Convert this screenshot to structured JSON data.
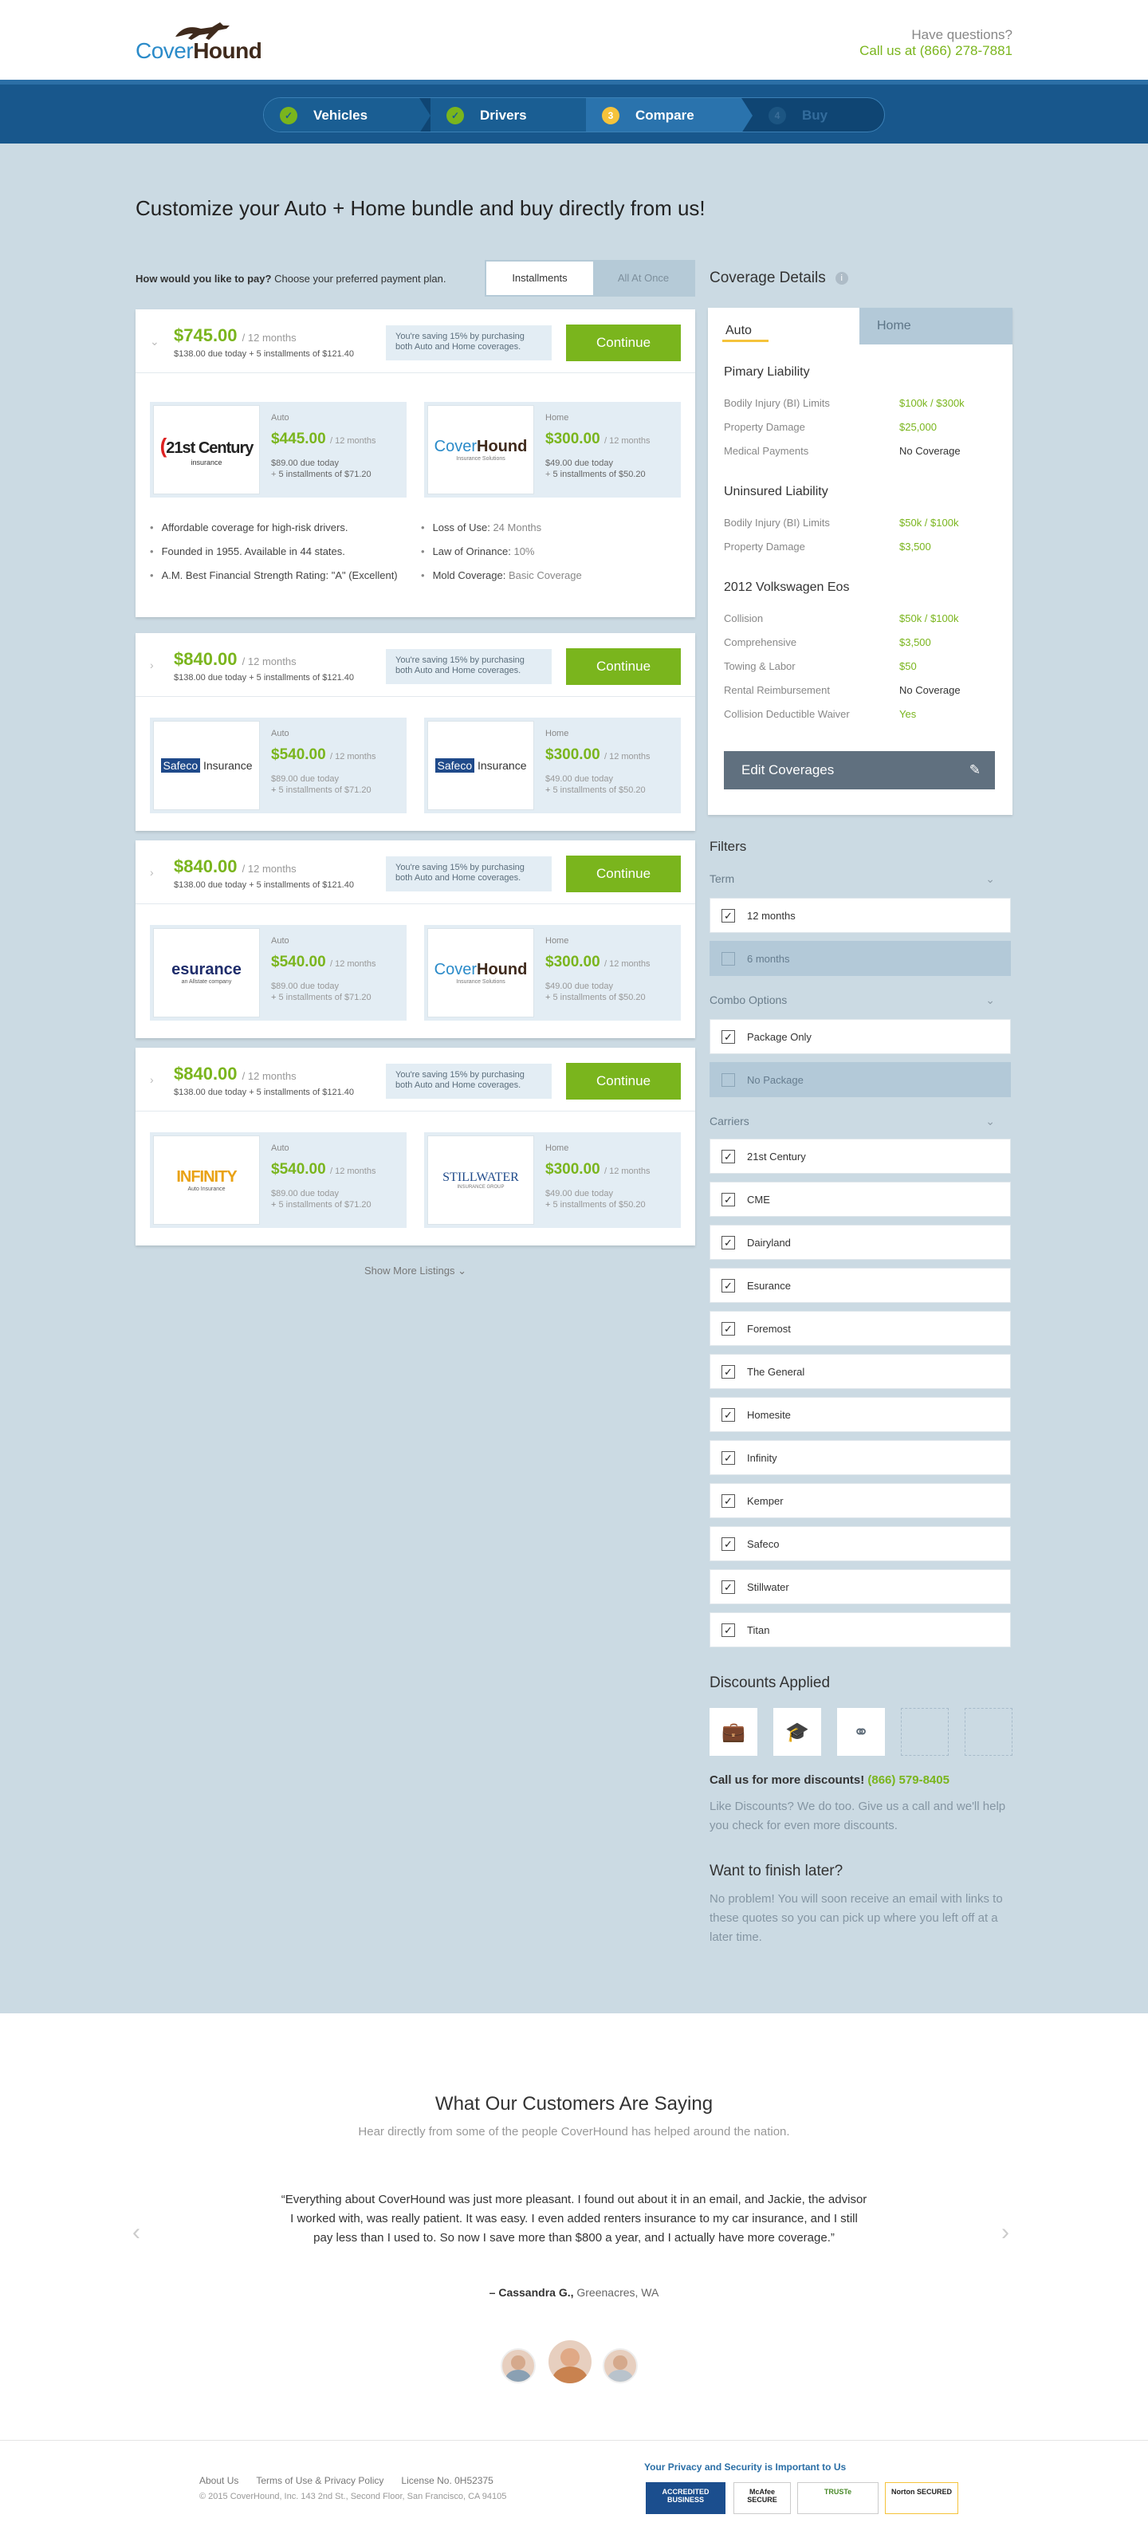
{
  "header": {
    "logo_a": "Cover",
    "logo_b": "Hound",
    "question": "Have questions?",
    "phone": "Call us at (866) 278-7881"
  },
  "steps": [
    {
      "num": "✓",
      "label": "Vehicles"
    },
    {
      "num": "✓",
      "label": "Drivers"
    },
    {
      "num": "3",
      "label": "Compare"
    },
    {
      "num": "4",
      "label": "Buy"
    }
  ],
  "page": {
    "title": "Customize your Auto + Home bundle and buy directly from us!",
    "pay_q": "How would you like to pay?",
    "pay_hint": "Choose your preferred payment plan.",
    "pay_opt1": "Installments",
    "pay_opt2": "All At Once"
  },
  "listings": [
    {
      "price": "$745.00",
      "term": "/ 12 months",
      "due": "$138.00 due today + 5 installments of $121.40",
      "saving": "You're saving 15% by purchasing both Auto and Home coverages.",
      "cta": "Continue",
      "auto": {
        "type": "Auto",
        "logo": "21st Century",
        "logo_sub": "insurance",
        "price": "$445.00",
        "term": "/ 12 months",
        "due": "$89.00 due today",
        "inst": "5 installments of $71.20"
      },
      "home": {
        "type": "Home",
        "logo_a": "Cover",
        "logo_b": "Hound",
        "logo_sub": "Insurance Solutions",
        "price": "$300.00",
        "term": "/ 12 months",
        "due": "$49.00 due today",
        "inst": "5 installments of $50.20"
      }
    },
    {
      "price": "$840.00",
      "term": "/ 12 months",
      "due": "$138.00 due today + 5 installments of $121.40",
      "saving": "You're saving 15% by purchasing both Auto and Home coverages.",
      "cta": "Continue",
      "auto": {
        "type": "Auto",
        "logo_a": "Safeco",
        "logo_b": "Insurance",
        "price": "$540.00",
        "term": "/ 12 months",
        "due": "$89.00 due today",
        "inst": "5 installments of $71.20"
      },
      "home": {
        "type": "Home",
        "logo_a": "Safeco",
        "logo_b": "Insurance",
        "price": "$300.00",
        "term": "/ 12 months",
        "due": "$49.00 due today",
        "inst": "5 installments of $50.20"
      }
    },
    {
      "price": "$840.00",
      "term": "/ 12 months",
      "due": "$138.00 due today + 5 installments of $121.40",
      "saving": "You're saving 15% by purchasing both Auto and Home coverages.",
      "cta": "Continue",
      "auto": {
        "type": "Auto",
        "logo": "esurance",
        "logo_sub": "an Allstate company",
        "price": "$540.00",
        "term": "/ 12 months",
        "due": "$89.00 due today",
        "inst": "5 installments of $71.20"
      },
      "home": {
        "type": "Home",
        "logo_a": "Cover",
        "logo_b": "Hound",
        "logo_sub": "Insurance Solutions",
        "price": "$300.00",
        "term": "/ 12 months",
        "due": "$49.00 due today",
        "inst": "5 installments of $50.20"
      }
    },
    {
      "price": "$840.00",
      "term": "/ 12 months",
      "due": "$138.00 due today + 5 installments of $121.40",
      "saving": "You're saving 15% by purchasing both Auto and Home coverages.",
      "cta": "Continue",
      "auto": {
        "type": "Auto",
        "logo": "INFINITY",
        "logo_sub": "Auto Insurance",
        "price": "$540.00",
        "term": "/ 12 months",
        "due": "$89.00 due today",
        "inst": "5 installments of $71.20"
      },
      "home": {
        "type": "Home",
        "logo": "STILLWATER",
        "logo_sub": "INSURANCE GROUP",
        "price": "$300.00",
        "term": "/ 12 months",
        "due": "$49.00 due today",
        "inst": "5 installments of $50.20"
      }
    }
  ],
  "features_left": [
    "Affordable coverage for high-risk drivers.",
    "Founded in 1955. Available in 44 states.",
    "A.M. Best Financial Strength Rating: \"A\" (Excellent)"
  ],
  "features_right": [
    {
      "label": "Loss of Use:",
      "value": "24 Months"
    },
    {
      "label": "Law of Orinance:",
      "value": "10%"
    },
    {
      "label": "Mold Coverage:",
      "value": "Basic Coverage"
    }
  ],
  "show_more": "Show More Listings",
  "coverage": {
    "title": "Coverage Details",
    "tab_auto": "Auto",
    "tab_home": "Home",
    "sections": [
      {
        "title": "Pimary Liability",
        "rows": [
          {
            "k": "Bodily Injury (BI) Limits",
            "v": "$100k / $300k"
          },
          {
            "k": "Property Damage",
            "v": "$25,000"
          },
          {
            "k": "Medical Payments",
            "v": "No Coverage"
          }
        ]
      },
      {
        "title": "Uninsured Liability",
        "rows": [
          {
            "k": "Bodily Injury (BI) Limits",
            "v": "$50k / $100k"
          },
          {
            "k": "Property Damage",
            "v": "$3,500"
          }
        ]
      },
      {
        "title": "2012 Volkswagen Eos",
        "rows": [
          {
            "k": "Collision",
            "v": "$50k / $100k"
          },
          {
            "k": "Comprehensive",
            "v": "$3,500"
          },
          {
            "k": "Towing & Labor",
            "v": "$50"
          },
          {
            "k": "Rental Reimbursement",
            "v": "No Coverage"
          },
          {
            "k": "Collision Deductible Waiver",
            "v": "Yes"
          }
        ]
      }
    ],
    "edit": "Edit Coverages"
  },
  "filters": {
    "title": "Filters",
    "term": "Term",
    "term_opts": [
      "12 months",
      "6 months"
    ],
    "combo": "Combo Options",
    "combo_opts": [
      "Package Only",
      "No Package"
    ],
    "carriers": "Carriers",
    "carrier_list": [
      "21st Century",
      "CME",
      "Dairyland",
      "Esurance",
      "Foremost",
      "The General",
      "Homesite",
      "Infinity",
      "Kemper",
      "Safeco",
      "Stillwater",
      "Titan"
    ]
  },
  "discounts": {
    "title": "Discounts Applied",
    "call": "Call us for more discounts!",
    "phone": "(866) 579-8405",
    "text": "Like Discounts? We do too. Give us a call and we'll help you check for even more discounts."
  },
  "later": {
    "title": "Want to finish later?",
    "text": "No problem! You will soon receive an email with links to these quotes so you can pick up where you left off at a later time."
  },
  "testimonials": {
    "title": "What Our Customers Are Saying",
    "subtitle": "Hear directly from some of the people CoverHound has helped around the nation.",
    "quote": "“Everything about CoverHound was just more pleasant. I found out about it in an email, and Jackie, the advisor I worked with, was really patient. It was easy. I even added renters insurance to my car insurance, and I still pay less than I used to. So now I save more than $800 a year, and I actually have more coverage.”",
    "author": "– Cassandra G.,",
    "location": "Greenacres, WA",
    "prev": "‹",
    "next": "›"
  },
  "footer": {
    "about": "About Us",
    "terms": "Terms of Use & Privacy Policy",
    "license": "License No. 0H52375",
    "copy": "© 2015 CoverHound, Inc. 143 2nd St., Second Floor, San Francisco, CA 94105",
    "security": "Your Privacy and Security is Important to Us",
    "badges": [
      "ACCREDITED BUSINESS",
      "McAfee SECURE",
      "TRUSTe",
      "Norton SECURED"
    ]
  }
}
